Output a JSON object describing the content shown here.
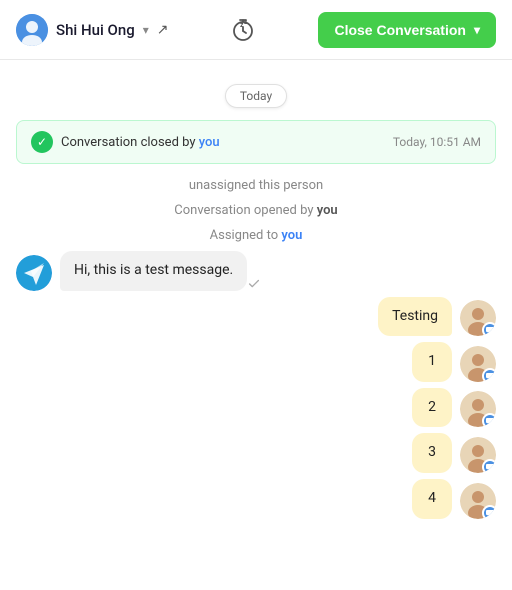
{
  "header": {
    "user_name": "Shi Hui Ong",
    "close_button_label": "Close Conversation",
    "dropdown_arrow": "▾"
  },
  "chat": {
    "date_label": "Today",
    "status_bar": {
      "text_prefix": "Conversation closed by ",
      "you_text": "you",
      "timestamp": "Today, 10:51 AM"
    },
    "activity": [
      {
        "text": "unassigned this person"
      },
      {
        "text_prefix": "Conversation opened by ",
        "bold_text": "you"
      },
      {
        "text_prefix": "Assigned to ",
        "bold_text": "you"
      }
    ],
    "messages": [
      {
        "id": 1,
        "type": "incoming",
        "text": "Hi, this is a test message.",
        "avatar_type": "telegram"
      },
      {
        "id": 2,
        "type": "outgoing",
        "text": "Testing",
        "avatar_type": "person"
      },
      {
        "id": 3,
        "type": "outgoing",
        "text": "1",
        "avatar_type": "person"
      },
      {
        "id": 4,
        "type": "outgoing",
        "text": "2",
        "avatar_type": "person"
      },
      {
        "id": 5,
        "type": "outgoing",
        "text": "3",
        "avatar_type": "person"
      },
      {
        "id": 6,
        "type": "outgoing",
        "text": "4",
        "avatar_type": "person"
      }
    ]
  }
}
